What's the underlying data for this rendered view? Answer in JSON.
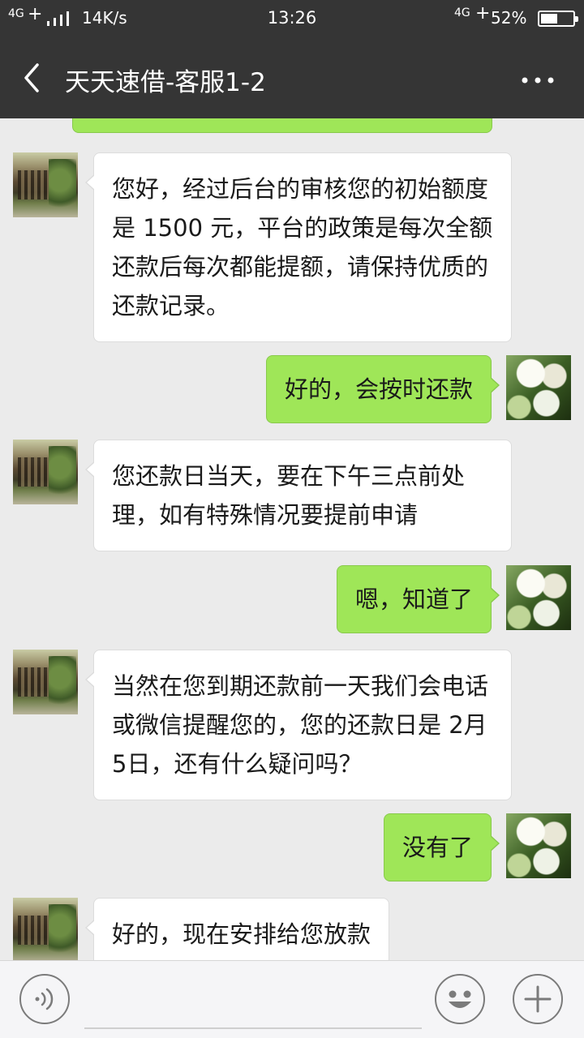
{
  "status": {
    "network_left": "4G",
    "speed": "14K/s",
    "time": "13:26",
    "network_right": "4G",
    "battery": "52%",
    "battery_level": 0.52
  },
  "header": {
    "title": "天天速借-客服1-2",
    "back_icon": "back-arrow-icon",
    "more_icon": "more-dots-icon"
  },
  "messages": [
    {
      "side": "left",
      "text": "您好，经过后台的审核您的初始额度是 1500 元，平台的政策是每次全额还款后每次都能提额，请保持优质的还款记录。"
    },
    {
      "side": "right",
      "text": "好的，会按时还款"
    },
    {
      "side": "left",
      "text": "您还款日当天，要在下午三点前处理，如有特殊情况要提前申请"
    },
    {
      "side": "right",
      "text": "嗯，知道了"
    },
    {
      "side": "left",
      "text": "当然在您到期还款前一天我们会电话或微信提醒您的，您的还款日是 2月 5日，还有什么疑问吗？"
    },
    {
      "side": "right",
      "text": "没有了"
    },
    {
      "side": "left",
      "text": "好的，现在安排给您放款"
    }
  ],
  "input_bar": {
    "voice_icon": "voice-icon",
    "emoji_icon": "emoji-icon",
    "add_icon": "add-icon"
  },
  "colors": {
    "header_bg": "#353535",
    "chat_bg": "#ebebeb",
    "sent_bubble": "#9fe658",
    "received_bubble": "#ffffff"
  }
}
